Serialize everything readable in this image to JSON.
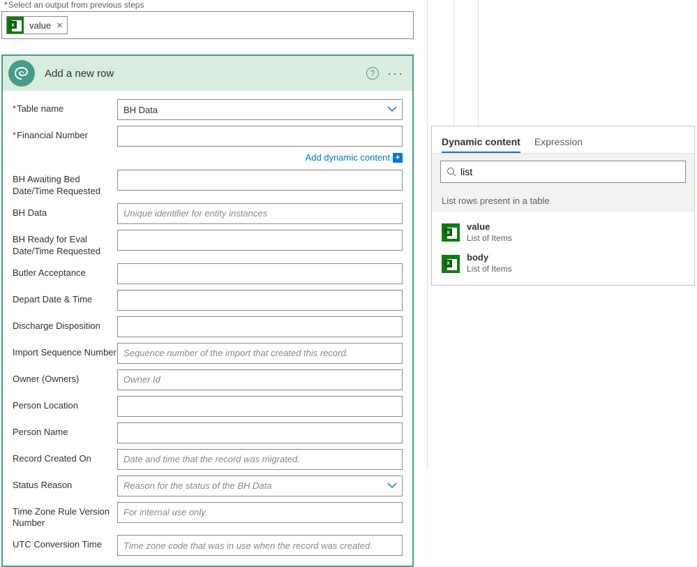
{
  "top": {
    "label": "Select an output from previous steps",
    "token": "value"
  },
  "action": {
    "title": "Add a new row",
    "add_dynamic": "Add dynamic content",
    "table_name_value": "BH Data",
    "fields": [
      {
        "label": "Table name",
        "required": true,
        "value": "BH Data",
        "dropdown": true
      },
      {
        "label": "Financial Number",
        "required": true,
        "value": ""
      },
      {
        "label": "BH Awaiting Bed Date/Time Requested",
        "value": ""
      },
      {
        "label": "BH Data",
        "placeholder": "Unique identifier for entity instances"
      },
      {
        "label": "BH Ready for Eval Date/Time Requested",
        "value": ""
      },
      {
        "label": "Butler Acceptance",
        "value": ""
      },
      {
        "label": "Depart Date & Time",
        "value": ""
      },
      {
        "label": "Discharge Disposition",
        "value": ""
      },
      {
        "label": "Import Sequence Number",
        "placeholder": "Sequence number of the import that created this record."
      },
      {
        "label": "Owner (Owners)",
        "placeholder": "Owner Id"
      },
      {
        "label": "Person Location",
        "value": ""
      },
      {
        "label": "Person Name",
        "value": ""
      },
      {
        "label": "Record Created On",
        "placeholder": "Date and time that the record was migrated."
      },
      {
        "label": "Status Reason",
        "placeholder": "Reason for the status of the BH Data",
        "dropdown": true
      },
      {
        "label": "Time Zone Rule Version Number",
        "placeholder": "For internal use only."
      },
      {
        "label": "UTC Conversion Time",
        "placeholder": "Time zone code that was in use when the record was created."
      }
    ]
  },
  "flyout": {
    "tabs": {
      "dynamic": "Dynamic content",
      "expression": "Expression"
    },
    "search": "list",
    "section": "List rows present in a table",
    "items": [
      {
        "title": "value",
        "sub": "List of Items"
      },
      {
        "title": "body",
        "sub": "List of Items"
      }
    ]
  }
}
